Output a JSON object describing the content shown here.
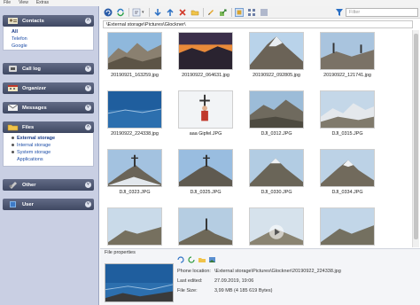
{
  "menu": [
    "File",
    "View",
    "Extras"
  ],
  "nav": {
    "contacts": {
      "label": "Contacts",
      "items": [
        "All",
        "Telefon",
        "Google"
      ]
    },
    "calllog": {
      "label": "Call log"
    },
    "organizer": {
      "label": "Organizer"
    },
    "messages": {
      "label": "Messages"
    },
    "files": {
      "label": "Files",
      "items": [
        "External storage",
        "Internal storage",
        "System storage",
        "Applications"
      ]
    },
    "other": {
      "label": "Other"
    },
    "user": {
      "label": "User"
    }
  },
  "toolbar": {
    "filter_placeholder": "Filter",
    "icons": [
      "refresh-icon",
      "sync-icon",
      "sort-icon",
      "download-icon",
      "upload-icon",
      "delete-icon",
      "folder-icon",
      "edit-icon",
      "share-icon",
      "large-thumbnails-icon",
      "medium-thumbnails-icon",
      "list-view-icon",
      "filter-icon"
    ]
  },
  "breadcrumb": "\\External storage\\Pictures\\Glockner\\",
  "gallery": {
    "files": [
      "20190921_163259.jpg",
      "20190922_064631.jpg",
      "20190922_092805.jpg",
      "20190922_121741.jpg",
      "20190922_224338.jpg",
      "aaa Gipfel.JPG",
      "DJI_0312.JPG",
      "DJI_0315.JPG",
      "DJI_0323.JPG",
      "DJI_0325.JPG",
      "DJI_0330.JPG",
      "DJI_0334.JPG",
      "",
      "",
      "",
      ""
    ]
  },
  "properties": {
    "title": "File properties",
    "phone_location_label": "Phone location:",
    "phone_location_value": "\\External storage\\Pictures\\Glockner\\20190922_224338.jpg",
    "last_edited_label": "Last edited:",
    "last_edited_value": "27.09.2019, 19:06",
    "file_size_label": "File Size:",
    "file_size_value": "3,99 MB  (4 185 619 Bytes)"
  }
}
